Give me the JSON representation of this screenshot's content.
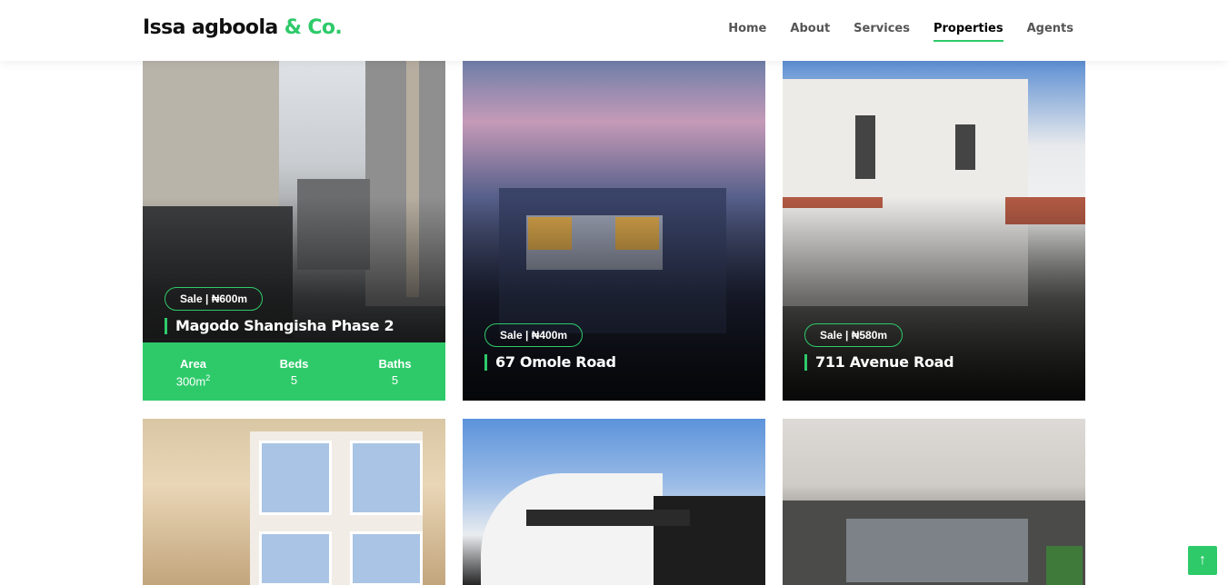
{
  "brand": {
    "name": "Issa agboola",
    "accent": "& Co."
  },
  "nav": [
    {
      "label": "Home"
    },
    {
      "label": "About"
    },
    {
      "label": "Services"
    },
    {
      "label": "Properties",
      "active": true
    },
    {
      "label": "Agents"
    }
  ],
  "properties": [
    {
      "badge": "Sale | ₦600m",
      "title": "Magodo Shangisha Phase 2",
      "stats": {
        "area_label": "Area",
        "area_value": "300m",
        "area_unit": "2",
        "beds_label": "Beds",
        "beds_value": "5",
        "baths_label": "Baths",
        "baths_value": "5"
      }
    },
    {
      "badge": "Sale | ₦400m",
      "title": "67 Omole Road"
    },
    {
      "badge": "Sale | ₦580m",
      "title": "711 Avenue Road"
    }
  ],
  "scroll_top_icon": "arrow-up-icon",
  "colors": {
    "accent": "#2eca6a"
  }
}
